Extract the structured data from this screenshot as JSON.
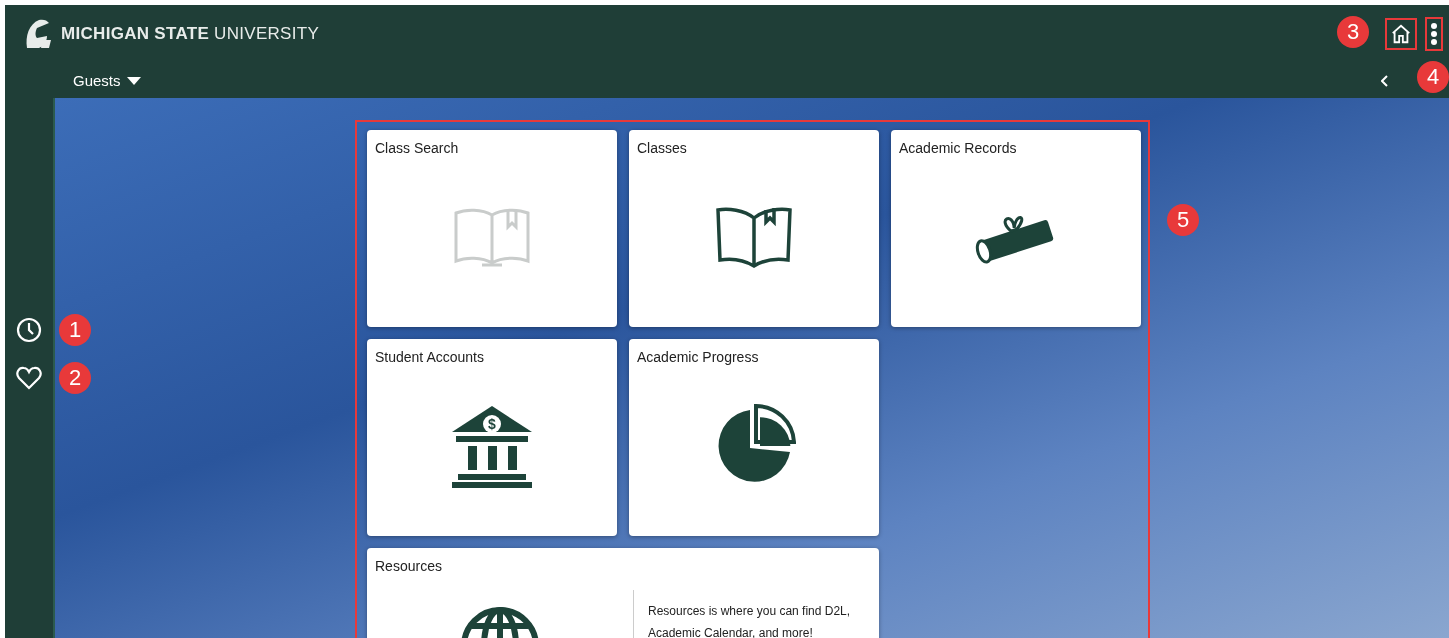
{
  "header": {
    "logo_text": "**MICHIGAN STATE** UNIVERSITY",
    "home_button": {
      "highlighted": true,
      "callout": "3"
    },
    "menu_button": {
      "highlighted": true,
      "callout": "4"
    },
    "user_menu": {
      "label": "Guests"
    }
  },
  "sidebar": {
    "items": [
      {
        "kind": "recent",
        "callout": "1"
      },
      {
        "kind": "favorites",
        "callout": "2"
      }
    ]
  },
  "tiles_panel": {
    "highlighted": true,
    "callout": "5",
    "tiles": [
      {
        "title": "Class Search",
        "kind": "search-book",
        "disabled": true,
        "wide": false
      },
      {
        "title": "Classes",
        "kind": "book",
        "disabled": false,
        "wide": false
      },
      {
        "title": "Academic Records",
        "kind": "diploma",
        "disabled": false,
        "wide": false
      },
      {
        "title": "Student Accounts",
        "kind": "bank",
        "disabled": false,
        "wide": false,
        "symbol": "$"
      },
      {
        "title": "Academic Progress",
        "kind": "pie",
        "disabled": false,
        "wide": false
      },
      {
        "title": "Resources",
        "kind": "globe",
        "disabled": false,
        "wide": true,
        "description": "Resources is where you can find D2L, Academic Calendar, and more!"
      }
    ]
  }
}
